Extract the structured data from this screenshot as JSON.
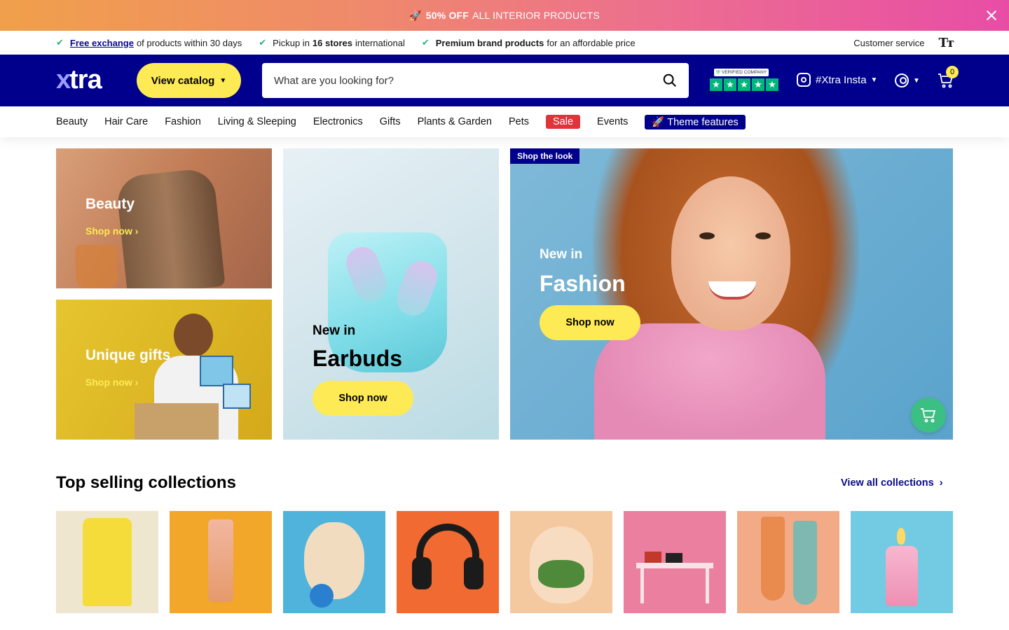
{
  "announcement": {
    "emoji": "🚀",
    "highlight": "50% OFF",
    "text": "ALL INTERIOR PRODUCTS"
  },
  "usp": {
    "items": [
      {
        "link": "Free exchange",
        "text": "of products within 30 days"
      },
      {
        "pre": "Pickup in",
        "bold": "16 stores",
        "post": "international"
      },
      {
        "bold": "Premium brand products",
        "post": "for an affordable price"
      }
    ],
    "customer_service": "Customer service",
    "text_size_icon": "Tт"
  },
  "header": {
    "logo_x": "x",
    "logo_rest": "tra",
    "catalog_label": "View catalog",
    "search_placeholder": "What are you looking for?",
    "trust_label": "VERIFIED COMPANY",
    "insta_label": "#Xtra Insta",
    "cart_count": "0"
  },
  "nav": {
    "items": [
      "Beauty",
      "Hair Care",
      "Fashion",
      "Living & Sleeping",
      "Electronics",
      "Gifts",
      "Plants & Garden",
      "Pets"
    ],
    "sale": "Sale",
    "events": "Events",
    "theme": "🚀 Theme features"
  },
  "banners": {
    "beauty": {
      "title": "Beauty",
      "link": "Shop now"
    },
    "gifts": {
      "title": "Unique gifts",
      "link": "Shop now"
    },
    "earbuds": {
      "kicker": "New in",
      "title": "Earbuds",
      "button": "Shop now"
    },
    "fashion": {
      "tag": "Shop the look",
      "kicker": "New in",
      "title": "Fashion",
      "button": "Shop now"
    }
  },
  "collections": {
    "title": "Top selling collections",
    "view_all": "View all collections",
    "items": [
      "banana-pants",
      "foundation-bottle",
      "puppy",
      "headphones",
      "terrarium",
      "pink-desk",
      "socks",
      "candle"
    ]
  },
  "colors": {
    "brand_navy": "#00008c",
    "accent_yellow": "#fdea55",
    "sale_red": "#e0333a",
    "check_green": "#34b074"
  }
}
